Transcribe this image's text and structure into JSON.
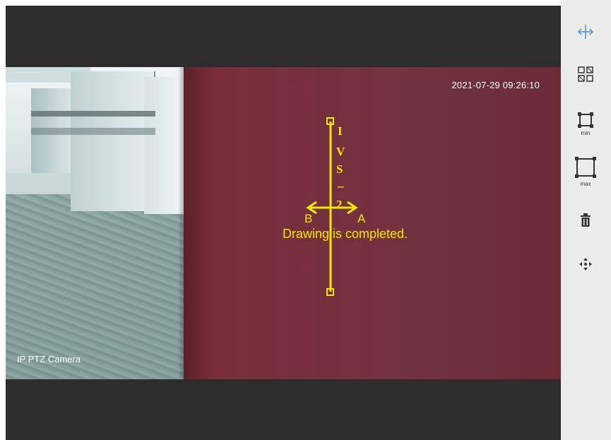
{
  "video": {
    "timestamp": "2021-07-29 09:26:10",
    "channel_name": "IP PTZ Camera",
    "top_left_osd": "··········"
  },
  "rule": {
    "name_chars": [
      "I",
      "V",
      "S",
      "_",
      "2"
    ],
    "direction_left": "B",
    "direction_right": "A",
    "status_message": "Drawing is completed."
  },
  "toolbar": {
    "tools": [
      {
        "icon": "draw-tripwire-icon",
        "active": true
      },
      {
        "icon": "region-grid-icon"
      },
      {
        "icon": "min-size-icon",
        "caption": "min"
      },
      {
        "icon": "max-size-icon",
        "caption": "max"
      },
      {
        "icon": "delete-icon"
      },
      {
        "icon": "move-icon"
      }
    ]
  },
  "colors": {
    "rule": "#f5e800",
    "active_tool": "#4a90d9",
    "tool": "#333333"
  }
}
